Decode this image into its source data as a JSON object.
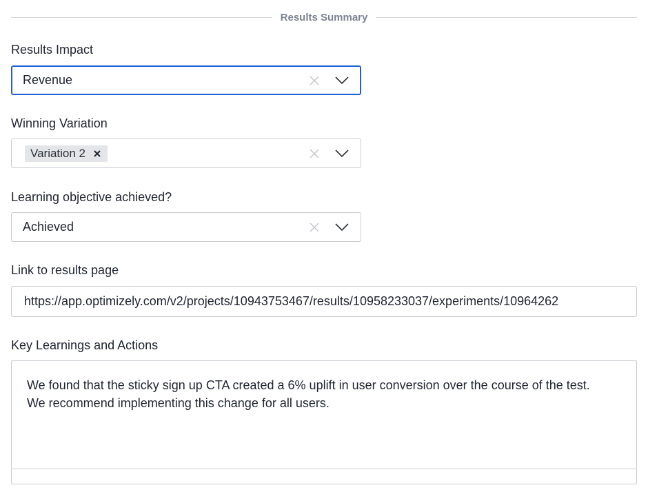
{
  "section": {
    "title": "Results Summary"
  },
  "results_impact": {
    "label": "Results Impact",
    "value": "Revenue"
  },
  "winning_variation": {
    "label": "Winning Variation",
    "tags": [
      "Variation 2"
    ]
  },
  "learning_objective": {
    "label": "Learning objective achieved?",
    "value": "Achieved"
  },
  "results_link": {
    "label": "Link to results page",
    "value": "https://app.optimizely.com/v2/projects/10943753467/results/10958233037/experiments/10964262"
  },
  "key_learnings": {
    "label": "Key Learnings and Actions",
    "text": "We found that the sticky sign up CTA created a 6% uplift in user conversion over the course of the test. We recommend implementing this change for all users."
  },
  "icons": {
    "clear": "close-icon",
    "dropdown": "chevron-down-icon",
    "tag_remove": "close-icon"
  },
  "colors": {
    "focus_border": "#1f5fd6",
    "input_border": "#c9ccd3",
    "tag_bg": "#e4e5e8",
    "section_title": "#7d8392"
  }
}
